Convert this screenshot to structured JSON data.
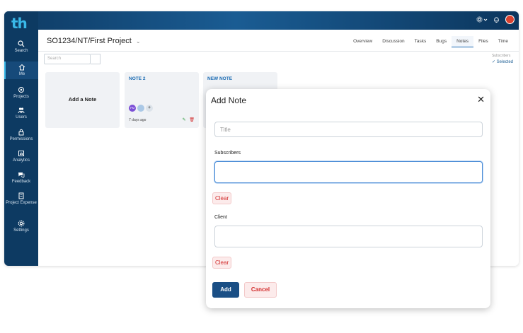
{
  "brand": {
    "logo": "th",
    "accent": "#39b8e8",
    "navy": "#0d3a62"
  },
  "sidebar": {
    "items": [
      {
        "label": "Search",
        "icon": "search-icon"
      },
      {
        "label": "Me",
        "icon": "home-icon"
      },
      {
        "label": "Projects",
        "icon": "projects-icon"
      },
      {
        "label": "Users",
        "icon": "users-icon"
      },
      {
        "label": "Permissions",
        "icon": "lock-icon"
      },
      {
        "label": "Analytics",
        "icon": "analytics-icon"
      },
      {
        "label": "Feedback",
        "icon": "chat-icon"
      },
      {
        "label": "Project Expense",
        "icon": "document-icon"
      },
      {
        "label": "Settings",
        "icon": "gear-icon"
      }
    ]
  },
  "header": {
    "project_title": "SO1234/NT/First Project",
    "tabs": [
      "Overview",
      "Discussion",
      "Tasks",
      "Bugs",
      "Notes",
      "Files",
      "Time"
    ],
    "active_tab": "Notes"
  },
  "toolbar": {
    "search_placeholder": "Search",
    "subscribers_label": "Subscribers",
    "subscribers_value": "Selected"
  },
  "notes": {
    "add_card_label": "Add a Note",
    "cards": [
      {
        "title": "NOTE 2",
        "avatar_initials": "PM",
        "time": "7 days ago"
      },
      {
        "title": "NEW NOTE"
      }
    ]
  },
  "modal": {
    "title": "Add Note",
    "title_placeholder": "Title",
    "subscribers_label": "Subscribers",
    "client_label": "Client",
    "clear_label": "Clear",
    "add_label": "Add",
    "cancel_label": "Cancel"
  }
}
